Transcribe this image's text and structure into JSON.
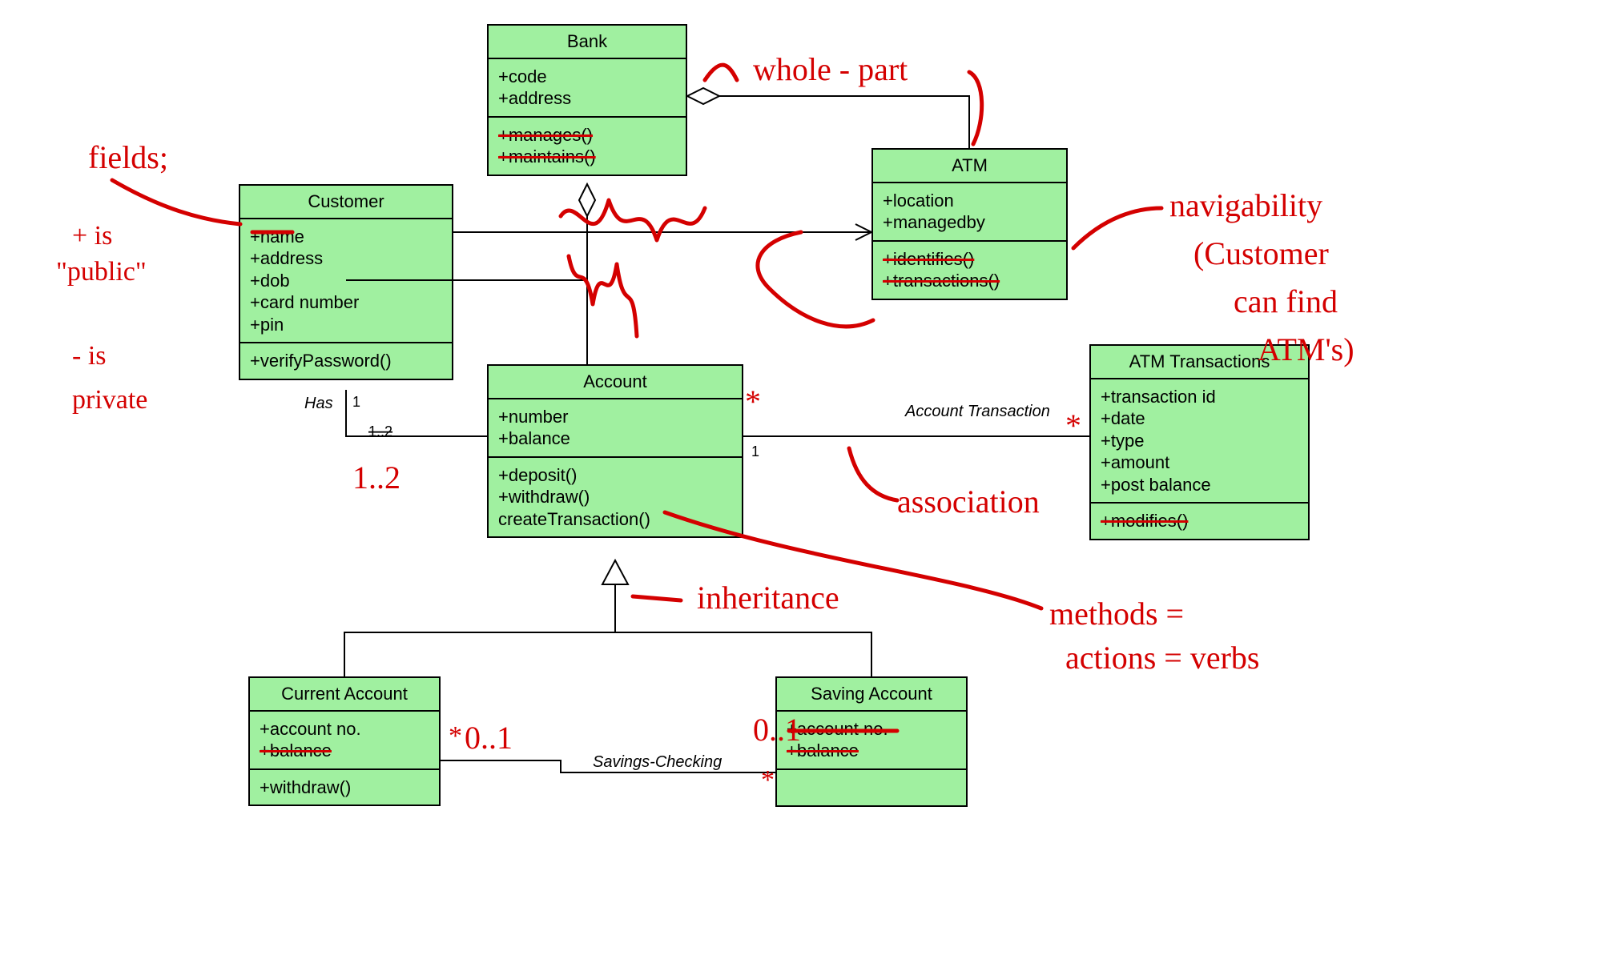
{
  "classes": {
    "bank": {
      "title": "Bank",
      "attrs": [
        "+code",
        "+address"
      ],
      "ops_struck": [
        "+manages()",
        "+maintains()"
      ]
    },
    "customer": {
      "title": "Customer",
      "attrs": [
        "+name",
        "+address",
        "+dob",
        "+card number",
        "+pin"
      ],
      "ops": [
        "+verifyPassword()"
      ]
    },
    "atm": {
      "title": "ATM",
      "attrs": [
        "+location",
        "+managedby"
      ],
      "ops_struck": [
        "+identifies()",
        "+transactions()"
      ]
    },
    "account": {
      "title": "Account",
      "attrs": [
        "+number",
        "+balance"
      ],
      "ops": [
        "+deposit()",
        "+withdraw()",
        "createTransaction()"
      ]
    },
    "atmtx": {
      "title": "ATM Transactions",
      "attrs": [
        "+transaction id",
        "+date",
        "+type",
        "+amount",
        "+post balance"
      ],
      "ops_struck": [
        "+modifies()"
      ]
    },
    "current": {
      "title": "Current Account",
      "attrs_first": "+account no.",
      "attrs_struck": [
        "+balance"
      ],
      "ops": [
        "+withdraw()"
      ]
    },
    "saving": {
      "title": "Saving Account",
      "attrs_first": "+account no.",
      "attrs_struck": [
        "+balance"
      ]
    }
  },
  "assoc": {
    "has_label": "Has",
    "has_mult_cust": "1",
    "has_mult_acct_struck": "1..2",
    "acct_tx_label": "Account Transaction",
    "acct_tx_mult": "1",
    "sav_chk_label": "Savings-Checking"
  },
  "hand": {
    "fields": "fields;",
    "pub1": "+ is",
    "pub2": "\"public\"",
    "priv1": "- is",
    "priv2": "private",
    "whole_part": "whole - part",
    "one_two": "1..2",
    "zero_one_left": "0..1",
    "zero_one_right": "0..1",
    "inheritance": "inheritance",
    "association": "association",
    "methods1": "methods =",
    "methods2": "actions = verbs",
    "nav1": "navigability",
    "nav2": "(Customer",
    "nav3": "can find",
    "nav4": "ATM's)",
    "star": "*",
    "star2": "*",
    "star3": "*"
  }
}
